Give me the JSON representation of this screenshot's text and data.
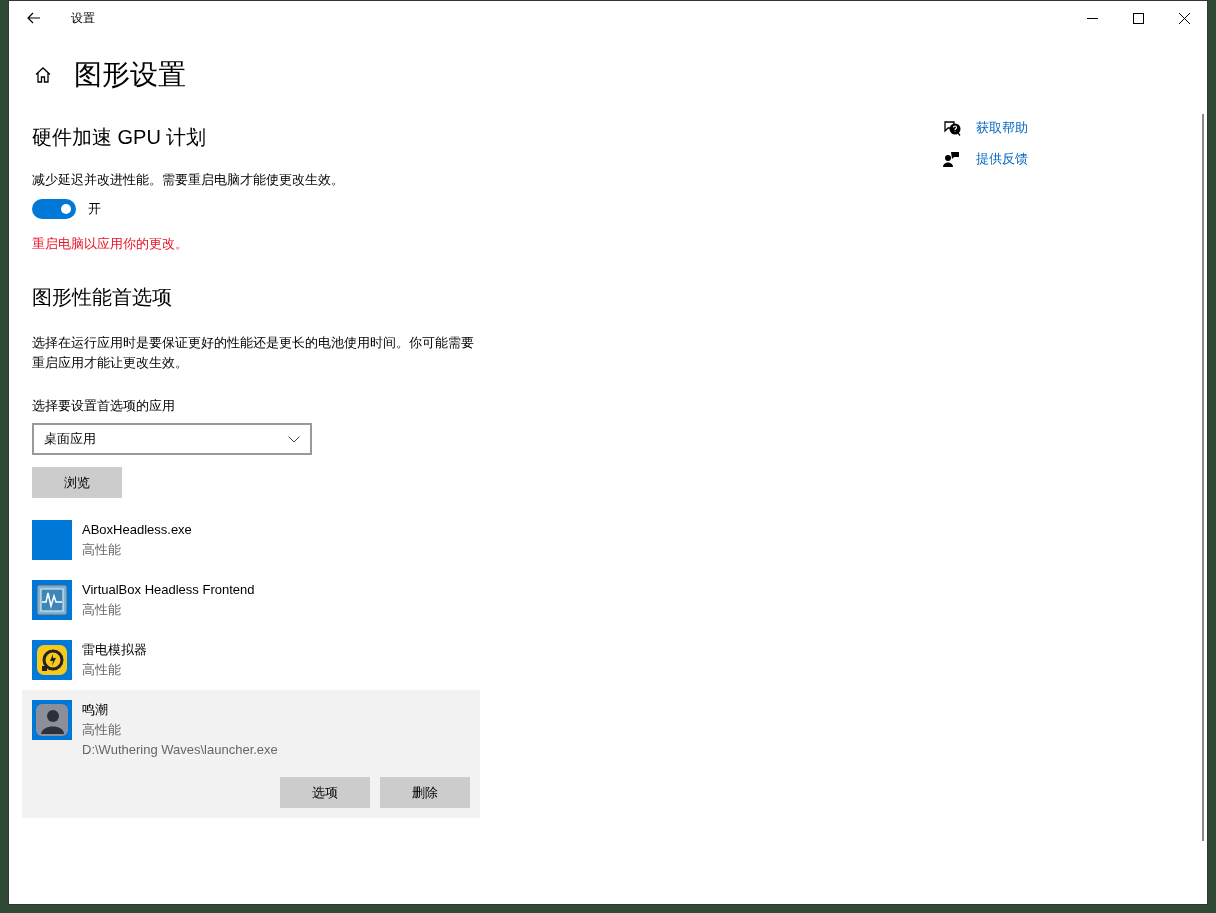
{
  "window": {
    "title": "设置"
  },
  "page": {
    "title": "图形设置"
  },
  "gpu_scheduling": {
    "heading": "硬件加速 GPU 计划",
    "description": "减少延迟并改进性能。需要重启电脑才能使更改生效。",
    "toggle": {
      "on": true,
      "label": "开"
    },
    "warning": "重启电脑以应用你的更改。"
  },
  "preference": {
    "heading": "图形性能首选项",
    "description": "选择在运行应用时是要保证更好的性能还是更长的电池使用时间。你可能需要重启应用才能让更改生效。",
    "select_label": "选择要设置首选项的应用",
    "select_value": "桌面应用",
    "browse_button": "浏览"
  },
  "apps": [
    {
      "name": "ABoxHeadless.exe",
      "setting": "高性能",
      "selected": false
    },
    {
      "name": "VirtualBox Headless Frontend",
      "setting": "高性能",
      "selected": false
    },
    {
      "name": "雷电模拟器",
      "setting": "高性能",
      "selected": false
    },
    {
      "name": "鸣潮",
      "setting": "高性能",
      "path": "D:\\Wuthering Waves\\launcher.exe",
      "selected": true,
      "buttons": [
        "选项",
        "删除"
      ]
    }
  ],
  "side_links": [
    {
      "label": "获取帮助"
    },
    {
      "label": "提供反馈"
    }
  ]
}
